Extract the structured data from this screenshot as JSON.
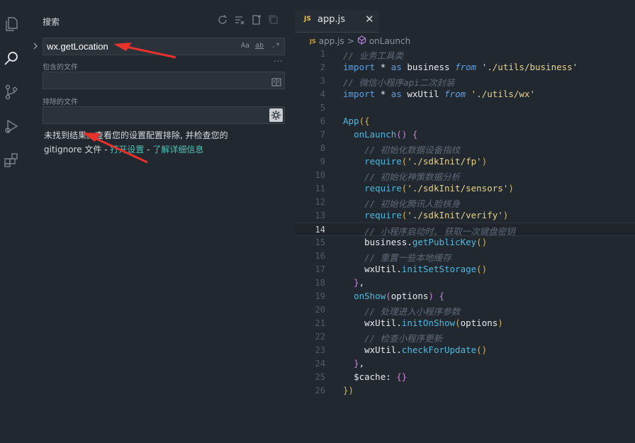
{
  "sidebar": {
    "title": "搜索",
    "search": {
      "value": "wx.getLocation",
      "opt_case": "Aa",
      "opt_word": "ab",
      "opt_regex": ".*"
    },
    "more": "···",
    "include_label": "包含的文件",
    "exclude_label": "排除的文件",
    "message": {
      "part1": "未找到结果。查看您的设置配置排除, 并检查您的 gitignore 文件 - ",
      "open_settings": "打开设置",
      "sep": " - ",
      "learn_more": "了解详细信息"
    }
  },
  "editor": {
    "tab": {
      "badge": "JS",
      "name": "app.js",
      "close": "✕"
    },
    "breadcrumb": {
      "badge": "JS",
      "file": "app.js",
      "sep": ">",
      "symbol": "onLaunch"
    },
    "active_line": 14,
    "lines": [
      {
        "n": "1",
        "html": "<span class='c'>// 业务工具类</span>"
      },
      {
        "n": "2",
        "html": "<span class='k'>import</span> <span class='v'>*</span> <span class='k'>as</span> <span class='v'>business</span> <span class='ki'>from</span> <span class='s'>'./utils/business'</span>"
      },
      {
        "n": "3",
        "html": "<span class='c'>// 微信小程序api二次封装</span>"
      },
      {
        "n": "4",
        "html": "<span class='k'>import</span> <span class='v'>*</span> <span class='k'>as</span> <span class='v'>wxUtil</span> <span class='ki'>from</span> <span class='s'>'./utils/wx'</span>"
      },
      {
        "n": "5",
        "html": ""
      },
      {
        "n": "6",
        "html": "<span class='f'>App</span><span class='p'>({</span>"
      },
      {
        "n": "7",
        "html": "  <span class='f'>onLaunch</span><span class='p2'>()</span> <span class='p2'>{</span>"
      },
      {
        "n": "8",
        "html": "    <span class='c'>// 初始化数据设备指纹</span>"
      },
      {
        "n": "9",
        "html": "    <span class='f'>require</span><span class='p'>(</span><span class='s'>'./sdkInit/fp'</span><span class='p'>)</span>"
      },
      {
        "n": "10",
        "html": "    <span class='c'>// 初始化神策数据分析</span>"
      },
      {
        "n": "11",
        "html": "    <span class='f'>require</span><span class='p'>(</span><span class='s'>'./sdkInit/sensors'</span><span class='p'>)</span>"
      },
      {
        "n": "12",
        "html": "    <span class='c'>// 初始化腾讯人脸核身</span>"
      },
      {
        "n": "13",
        "html": "    <span class='f'>require</span><span class='p'>(</span><span class='s'>'./sdkInit/verify'</span><span class='p'>)</span>"
      },
      {
        "n": "14",
        "html": "    <span class='c'>// 小程序启动时, 获取一次键盘密钥</span>"
      },
      {
        "n": "15",
        "html": "    <span class='v'>business</span><span class='v'>.</span><span class='f'>getPublicKey</span><span class='p'>()</span>"
      },
      {
        "n": "16",
        "html": "    <span class='c'>// 重置一些本地缓存</span>"
      },
      {
        "n": "17",
        "html": "    <span class='v'>wxUtil</span><span class='v'>.</span><span class='f'>initSetStorage</span><span class='p'>()</span>"
      },
      {
        "n": "18",
        "html": "  <span class='p2'>}</span><span class='v'>,</span>"
      },
      {
        "n": "19",
        "html": "  <span class='f'>onShow</span><span class='p2'>(</span><span class='v'>options</span><span class='p2'>)</span> <span class='p2'>{</span>"
      },
      {
        "n": "20",
        "html": "    <span class='c'>// 处理进入小程序参数</span>"
      },
      {
        "n": "21",
        "html": "    <span class='v'>wxUtil</span><span class='v'>.</span><span class='f'>initOnShow</span><span class='p'>(</span><span class='v'>options</span><span class='p'>)</span>"
      },
      {
        "n": "22",
        "html": "    <span class='c'>// 检查小程序更新</span>"
      },
      {
        "n": "23",
        "html": "    <span class='v'>wxUtil</span><span class='v'>.</span><span class='f'>checkForUpdate</span><span class='p'>()</span>"
      },
      {
        "n": "24",
        "html": "  <span class='p2'>}</span><span class='v'>,</span>"
      },
      {
        "n": "25",
        "html": "  <span class='v'>$cache</span><span class='v'>:</span> <span class='p2'>{}</span>"
      },
      {
        "n": "26",
        "html": "<span class='p'>})</span>"
      }
    ]
  },
  "colors": {
    "background": "#22282f",
    "accent": "#4fc1b8",
    "arrow": "#e5322d"
  }
}
